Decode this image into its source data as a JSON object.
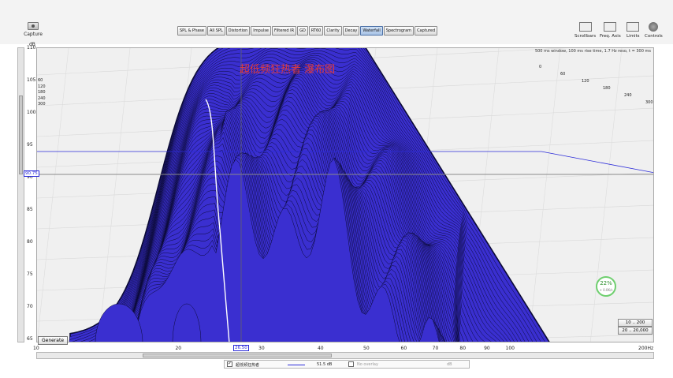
{
  "toolbar": {
    "capture_label": "Capture",
    "tabs": [
      "SPL & Phase",
      "All SPL",
      "Distortion",
      "Impulse",
      "Filtered IR",
      "GD",
      "RT60",
      "Clarity",
      "Decay",
      "Waterfall",
      "Spectrogram",
      "Captured"
    ],
    "active_tab": "Waterfall",
    "right_tools": [
      "Scrollbars",
      "Freq. Axis",
      "Limits",
      "Controls"
    ]
  },
  "plot": {
    "title": "超低频狂热者 瀑布图",
    "info_note": "500 ms window, 100 ms rise time, 1.7 Hz reso, t = 300 ms",
    "y_unit": "dB",
    "y_ticks": [
      "110",
      "105",
      "100",
      "95",
      "90",
      "85",
      "80",
      "75",
      "70",
      "65"
    ],
    "x_ticks": [
      "10",
      "20",
      "30",
      "40",
      "50",
      "60",
      "70",
      "80",
      "90",
      "100",
      "200Hz"
    ],
    "time_ticks": [
      "0",
      "60",
      "120",
      "180",
      "240",
      "300"
    ],
    "time_ticks_left": [
      "60",
      "120",
      "180",
      "240",
      "300"
    ],
    "cursor_db": "90.75",
    "cursor_hz": "26.50",
    "generate_label": "Generate",
    "range_buttons": [
      "10 .. 200",
      "20 .. 20,000"
    ],
    "gauge_value": "22%",
    "gauge_sub": "+ 0.0K/s"
  },
  "legend": {
    "trace_name": "超低频狂热者",
    "trace_value": "51.5 dB",
    "overlay_label": "No overlay",
    "overlay_value": "dB"
  },
  "colors": {
    "waterfall": "#3a2fd0",
    "waterfall_line": "#0b0a35",
    "cursor": "#2b2bd9",
    "title": "#e23b3b"
  }
}
